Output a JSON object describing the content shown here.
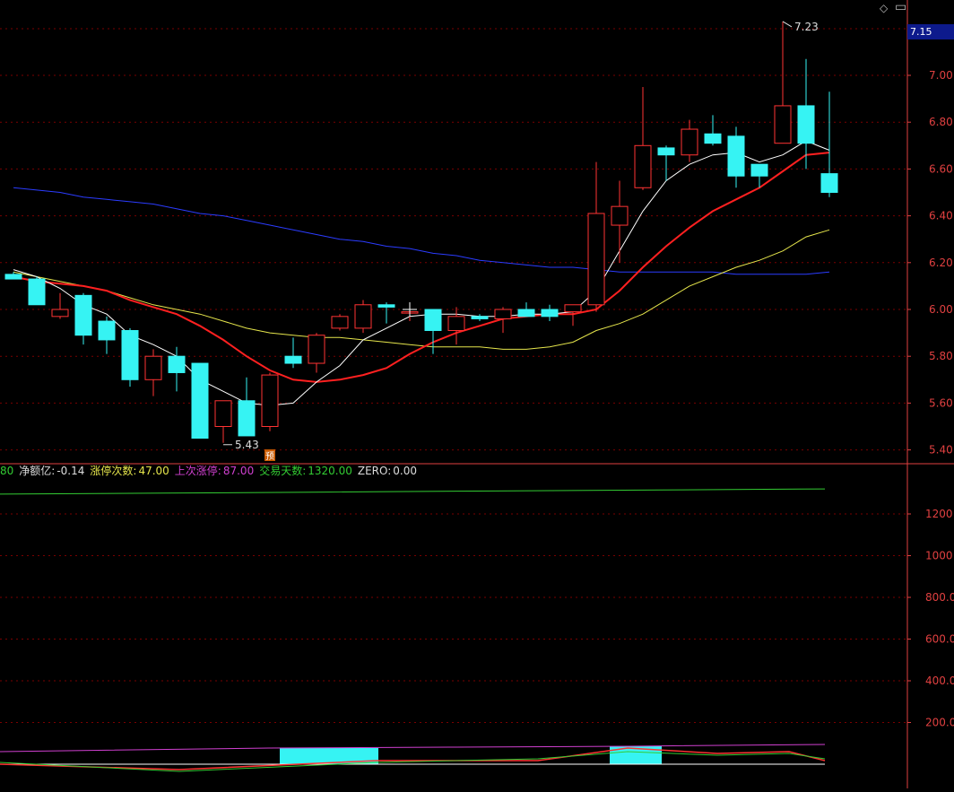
{
  "header": {
    "diamond_icon": "diamond-icon",
    "minimize_icon": "minimize-icon"
  },
  "price_tag": "7.15",
  "indicators": {
    "prefix": "80",
    "net_label": "净额亿:",
    "net_value": "-0.14",
    "limitup_label": "涨停次数:",
    "limitup_value": "47.00",
    "last_label": "上次涨停:",
    "last_value": "87.00",
    "days_label": "交易天数:",
    "days_value": "1320.00",
    "zero_label": "ZERO:",
    "zero_value": "0.00"
  },
  "colors": {
    "up": "#ff3333",
    "down": "#36f3f3",
    "ma5": "#ffffff",
    "ma10": "#ff2020",
    "ma20": "#e6e64c",
    "ma60": "#2b3cff",
    "green_line": "#33cc33",
    "grid": "#7a0000",
    "axis": "#e04040"
  },
  "chart_data": [
    {
      "type": "candlestick",
      "y_axis_ticks": [
        "7.00",
        "6.80",
        "6.60",
        "6.40",
        "6.20",
        "6.00",
        "5.80",
        "5.60",
        "5.40"
      ],
      "ylim": [
        5.36,
        7.25
      ],
      "high_label": "7.23",
      "low_label": "5.43",
      "marker_label": "预",
      "candles": [
        {
          "o": 6.15,
          "h": 6.16,
          "l": 6.13,
          "c": 6.13
        },
        {
          "o": 6.13,
          "h": 6.14,
          "l": 6.02,
          "c": 6.02
        },
        {
          "o": 5.97,
          "h": 6.07,
          "l": 5.96,
          "c": 6.0
        },
        {
          "o": 6.06,
          "h": 6.07,
          "l": 5.85,
          "c": 5.89
        },
        {
          "o": 5.95,
          "h": 5.97,
          "l": 5.81,
          "c": 5.87
        },
        {
          "o": 5.91,
          "h": 5.92,
          "l": 5.67,
          "c": 5.7
        },
        {
          "o": 5.7,
          "h": 5.83,
          "l": 5.63,
          "c": 5.8
        },
        {
          "o": 5.8,
          "h": 5.84,
          "l": 5.65,
          "c": 5.73
        },
        {
          "o": 5.77,
          "h": 5.77,
          "l": 5.45,
          "c": 5.45
        },
        {
          "o": 5.5,
          "h": 5.61,
          "l": 5.43,
          "c": 5.61
        },
        {
          "o": 5.61,
          "h": 5.71,
          "l": 5.46,
          "c": 5.46
        },
        {
          "o": 5.5,
          "h": 5.73,
          "l": 5.48,
          "c": 5.72
        },
        {
          "o": 5.8,
          "h": 5.88,
          "l": 5.75,
          "c": 5.77
        },
        {
          "o": 5.77,
          "h": 5.9,
          "l": 5.73,
          "c": 5.89
        },
        {
          "o": 5.92,
          "h": 5.98,
          "l": 5.91,
          "c": 5.97
        },
        {
          "o": 5.92,
          "h": 6.04,
          "l": 5.9,
          "c": 6.02
        },
        {
          "o": 6.02,
          "h": 6.03,
          "l": 5.94,
          "c": 6.01
        },
        {
          "o": 5.99,
          "h": 6.0,
          "l": 5.95,
          "c": 5.99
        },
        {
          "o": 6.0,
          "h": 6.0,
          "l": 5.81,
          "c": 5.91
        },
        {
          "o": 5.91,
          "h": 6.01,
          "l": 5.85,
          "c": 5.97
        },
        {
          "o": 5.97,
          "h": 5.98,
          "l": 5.95,
          "c": 5.96
        },
        {
          "o": 5.96,
          "h": 6.01,
          "l": 5.9,
          "c": 6.0
        },
        {
          "o": 6.0,
          "h": 6.03,
          "l": 5.97,
          "c": 5.97
        },
        {
          "o": 6.0,
          "h": 6.02,
          "l": 5.95,
          "c": 5.97
        },
        {
          "o": 5.99,
          "h": 6.02,
          "l": 5.93,
          "c": 6.02
        },
        {
          "o": 6.02,
          "h": 6.63,
          "l": 5.99,
          "c": 6.41
        },
        {
          "o": 6.36,
          "h": 6.55,
          "l": 6.2,
          "c": 6.44
        },
        {
          "o": 6.52,
          "h": 6.95,
          "l": 6.51,
          "c": 6.7
        },
        {
          "o": 6.69,
          "h": 6.7,
          "l": 6.55,
          "c": 6.66
        },
        {
          "o": 6.66,
          "h": 6.81,
          "l": 6.63,
          "c": 6.77
        },
        {
          "o": 6.75,
          "h": 6.83,
          "l": 6.7,
          "c": 6.71
        },
        {
          "o": 6.74,
          "h": 6.78,
          "l": 6.52,
          "c": 6.57
        },
        {
          "o": 6.62,
          "h": 6.62,
          "l": 6.52,
          "c": 6.57
        },
        {
          "o": 6.71,
          "h": 7.23,
          "l": 6.71,
          "c": 6.87
        },
        {
          "o": 6.87,
          "h": 7.07,
          "l": 6.6,
          "c": 6.71
        },
        {
          "o": 6.58,
          "h": 6.93,
          "l": 6.48,
          "c": 6.5
        }
      ],
      "ma5": [
        6.17,
        6.14,
        6.09,
        6.02,
        5.98,
        5.89,
        5.85,
        5.8,
        5.7,
        5.65,
        5.6,
        5.59,
        5.6,
        5.69,
        5.76,
        5.87,
        5.92,
        5.97,
        5.98,
        5.98,
        5.97,
        5.97,
        5.98,
        5.98,
        5.99,
        6.08,
        6.25,
        6.42,
        6.55,
        6.62,
        6.66,
        6.67,
        6.63,
        6.66,
        6.72,
        6.68
      ],
      "ma10": [
        6.14,
        6.12,
        6.11,
        6.1,
        6.08,
        6.04,
        6.01,
        5.98,
        5.93,
        5.87,
        5.8,
        5.74,
        5.7,
        5.69,
        5.7,
        5.72,
        5.75,
        5.81,
        5.86,
        5.9,
        5.93,
        5.96,
        5.97,
        5.98,
        5.98,
        6.0,
        6.08,
        6.18,
        6.27,
        6.35,
        6.42,
        6.47,
        6.52,
        6.59,
        6.66,
        6.67
      ],
      "ma20": [
        6.16,
        6.14,
        6.12,
        6.1,
        6.08,
        6.05,
        6.02,
        6.0,
        5.98,
        5.95,
        5.92,
        5.9,
        5.89,
        5.88,
        5.88,
        5.87,
        5.86,
        5.85,
        5.84,
        5.84,
        5.84,
        5.83,
        5.83,
        5.84,
        5.86,
        5.91,
        5.94,
        5.98,
        6.04,
        6.1,
        6.14,
        6.18,
        6.21,
        6.25,
        6.31,
        6.34
      ],
      "ma60": [
        6.52,
        6.51,
        6.5,
        6.48,
        6.47,
        6.46,
        6.45,
        6.43,
        6.41,
        6.4,
        6.38,
        6.36,
        6.34,
        6.32,
        6.3,
        6.29,
        6.27,
        6.26,
        6.24,
        6.23,
        6.21,
        6.2,
        6.19,
        6.18,
        6.18,
        6.17,
        6.16,
        6.16,
        6.16,
        6.16,
        6.16,
        6.15,
        6.15,
        6.15,
        6.15,
        6.16
      ]
    },
    {
      "type": "line",
      "y_axis_ticks": [
        "1200",
        "1000",
        "800.0",
        "600.0",
        "400.0",
        "200.0"
      ],
      "ylim": [
        0,
        1400
      ],
      "series": [
        {
          "values": [
            1295,
            1300,
            1305,
            1310,
            1315,
            1320
          ]
        }
      ]
    }
  ]
}
